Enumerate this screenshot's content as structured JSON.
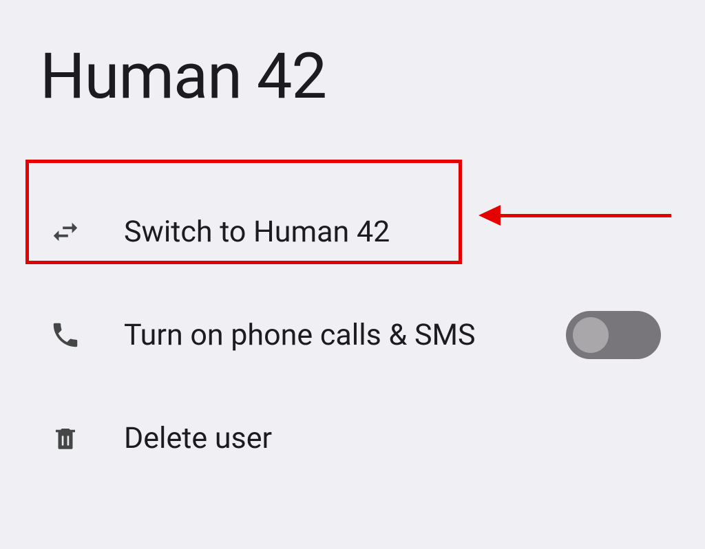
{
  "title": "Human 42",
  "rows": {
    "switch": {
      "label": "Switch to Human 42"
    },
    "phone": {
      "label": "Turn on phone calls & SMS",
      "toggle_on": false
    },
    "delete": {
      "label": "Delete user"
    }
  },
  "annotation": {
    "highlight_color": "#e30000"
  }
}
